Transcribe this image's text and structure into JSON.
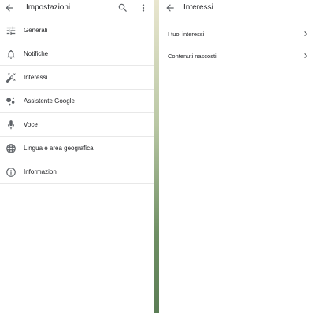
{
  "left_panel": {
    "title": "Impostazioni",
    "items": [
      {
        "label": "Generali",
        "icon": "tune-icon"
      },
      {
        "label": "Notifiche",
        "icon": "bell-icon"
      },
      {
        "label": "Interessi",
        "icon": "magic-wand-icon"
      },
      {
        "label": "Assistente Google",
        "icon": "google-assistant-icon"
      },
      {
        "label": "Voce",
        "icon": "microphone-icon"
      },
      {
        "label": "Lingua e area geografica",
        "icon": "globe-icon"
      },
      {
        "label": "Informazioni",
        "icon": "info-icon"
      }
    ]
  },
  "right_panel": {
    "title": "Interessi",
    "items": [
      {
        "label": "I tuoi interessi"
      },
      {
        "label": "Contenuti nascosti"
      }
    ]
  },
  "colors": {
    "text": "#202124",
    "icon": "#5f6368",
    "divider": "#e8e8e8",
    "background": "#ffffff"
  }
}
